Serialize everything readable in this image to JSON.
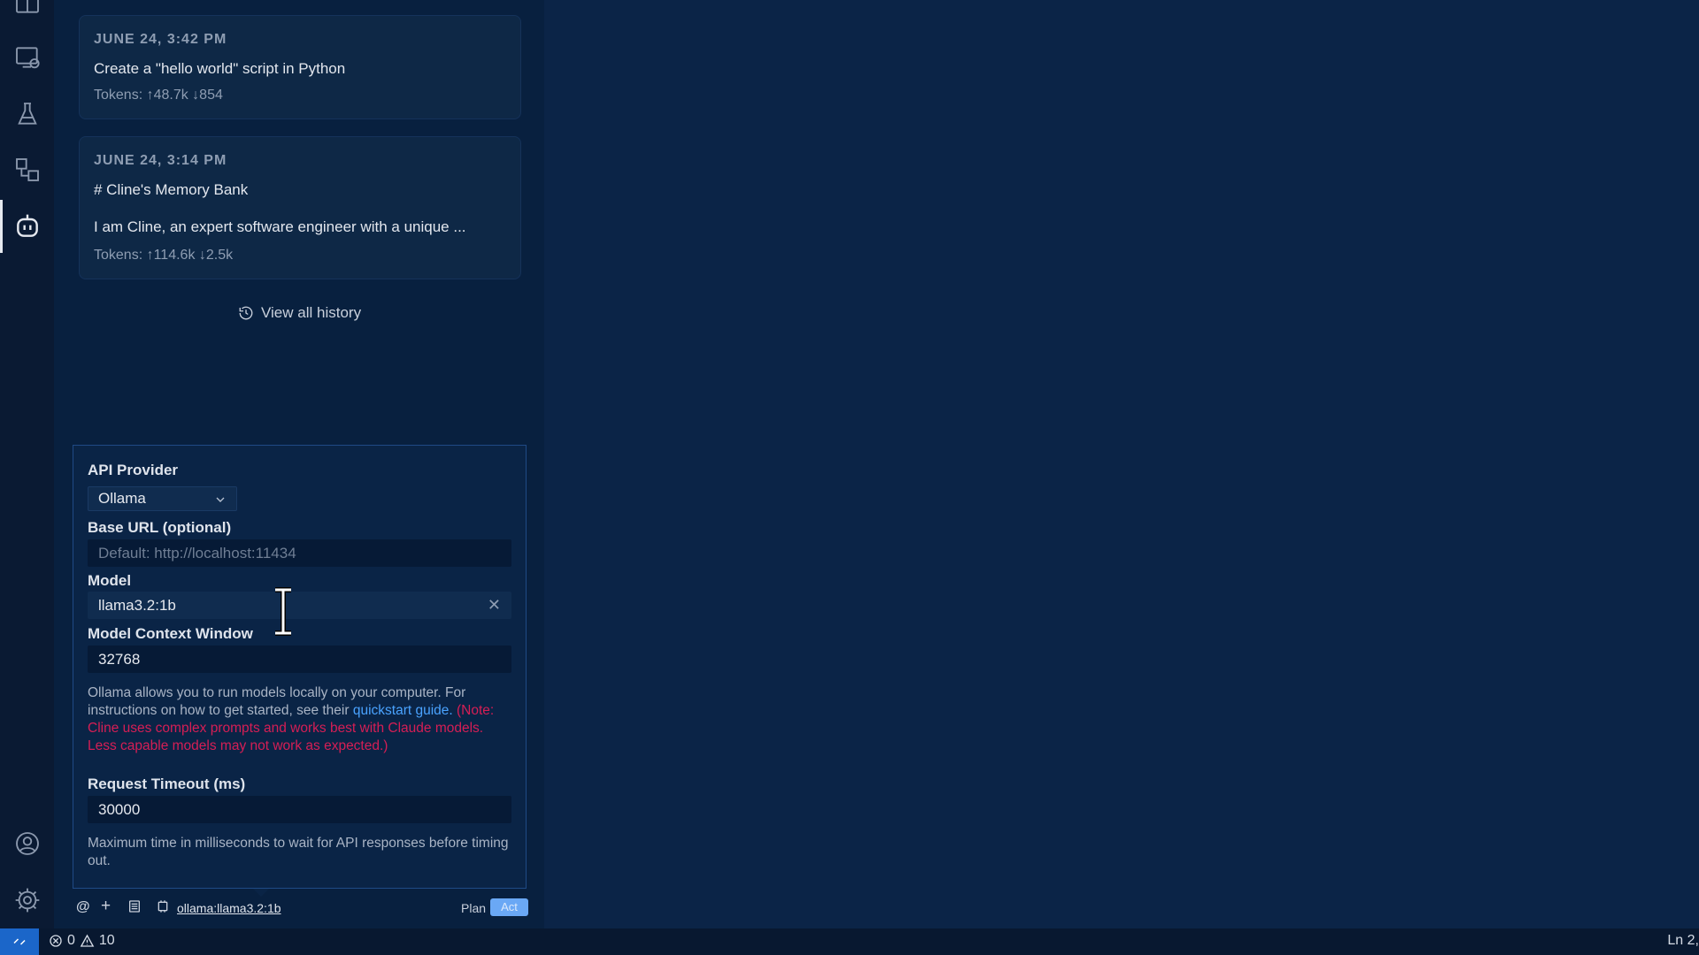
{
  "history": [
    {
      "date": "JUNE 24, 3:42 PM",
      "title": "Create a \"hello world\" script in Python",
      "snippet": "",
      "tokens": "Tokens: ↑48.7k ↓854"
    },
    {
      "date": "JUNE 24, 3:14 PM",
      "title": "# Cline's Memory Bank",
      "snippet": "I am Cline, an expert software engineer with a unique ...",
      "tokens": "Tokens: ↑114.6k ↓2.5k"
    }
  ],
  "view_all_history": "View all history",
  "settings": {
    "api_provider_label": "API Provider",
    "api_provider_value": "Ollama",
    "base_url_label": "Base URL (optional)",
    "base_url_placeholder": "Default: http://localhost:11434",
    "model_label": "Model",
    "model_value": "llama3.2:1b",
    "context_window_label": "Model Context Window",
    "context_window_value": "32768",
    "ollama_desc_1": "Ollama allows you to run models locally on your computer. For instructions on how to get started, see their ",
    "ollama_desc_link": "quickstart guide.",
    "ollama_warning": "(Note: Cline uses complex prompts and works best with Claude models. Less capable models may not work as expected.)",
    "timeout_label": "Request Timeout (ms)",
    "timeout_value": "30000",
    "timeout_desc": "Maximum time in milliseconds to wait for API responses before timing out."
  },
  "bottom_bar": {
    "mention": "@",
    "add": "+",
    "model_link": "ollama:llama3.2:1b",
    "plan": "Plan",
    "act": "Act"
  },
  "status_bar": {
    "errors": "0",
    "warnings": "10",
    "position": "Ln 2,"
  },
  "icons": {
    "activity_bar": [
      "explorer-icon",
      "remote-explorer-icon",
      "testing-icon",
      "extensions-icon",
      "cline-icon",
      "account-icon",
      "settings-gear-icon"
    ]
  }
}
